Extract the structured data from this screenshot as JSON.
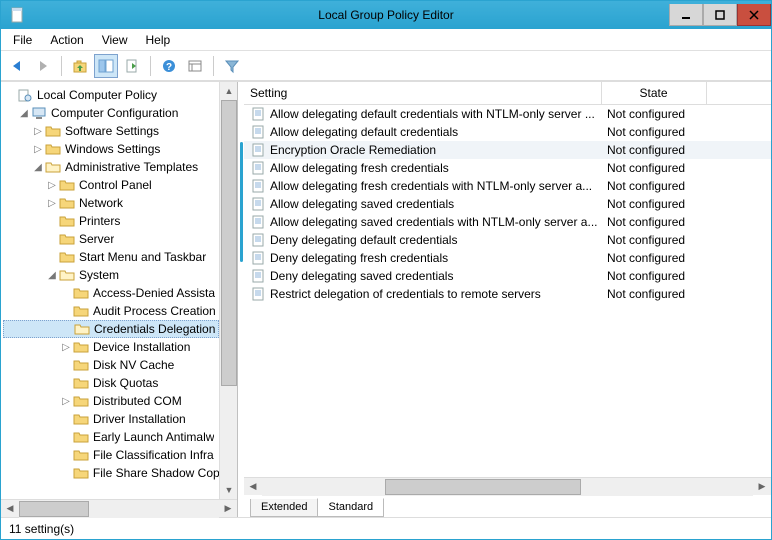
{
  "title": "Local Group Policy Editor",
  "menu": [
    "File",
    "Action",
    "View",
    "Help"
  ],
  "toolbar": {
    "back": "back-icon",
    "forward": "forward-icon",
    "up": "up-icon",
    "options": "options-icon",
    "export": "export-icon",
    "help": "help-icon",
    "show": "show-icon",
    "filter": "filter-icon"
  },
  "tree": {
    "root": "Local Computer Policy",
    "cc": "Computer Configuration",
    "sw": "Software Settings",
    "ws": "Windows Settings",
    "at": "Administrative Templates",
    "cp": "Control Panel",
    "net": "Network",
    "pr": "Printers",
    "srv": "Server",
    "smt": "Start Menu and Taskbar",
    "sys": "System",
    "ada": "Access-Denied Assista",
    "apc": "Audit Process Creation",
    "cd": "Credentials Delegation",
    "di": "Device Installation",
    "dnv": "Disk NV Cache",
    "dq": "Disk Quotas",
    "dcom": "Distributed COM",
    "drvi": "Driver Installation",
    "elam": "Early Launch Antimalw",
    "fci": "File Classification Infra",
    "fssc": "File Share Shadow Cop"
  },
  "columns": {
    "setting": "Setting",
    "state": "State"
  },
  "settings": [
    {
      "name": "Allow delegating default credentials with NTLM-only server ...",
      "state": "Not configured"
    },
    {
      "name": "Allow delegating default credentials",
      "state": "Not configured"
    },
    {
      "name": "Encryption Oracle Remediation",
      "state": "Not configured",
      "selected": true
    },
    {
      "name": "Allow delegating fresh credentials",
      "state": "Not configured"
    },
    {
      "name": "Allow delegating fresh credentials with NTLM-only server a...",
      "state": "Not configured"
    },
    {
      "name": "Allow delegating saved credentials",
      "state": "Not configured"
    },
    {
      "name": "Allow delegating saved credentials with NTLM-only server a...",
      "state": "Not configured"
    },
    {
      "name": "Deny delegating default credentials",
      "state": "Not configured"
    },
    {
      "name": "Deny delegating fresh credentials",
      "state": "Not configured"
    },
    {
      "name": "Deny delegating saved credentials",
      "state": "Not configured"
    },
    {
      "name": "Restrict delegation of credentials to remote servers",
      "state": "Not configured"
    }
  ],
  "tabs": {
    "extended": "Extended",
    "standard": "Standard"
  },
  "status": "11 setting(s)"
}
